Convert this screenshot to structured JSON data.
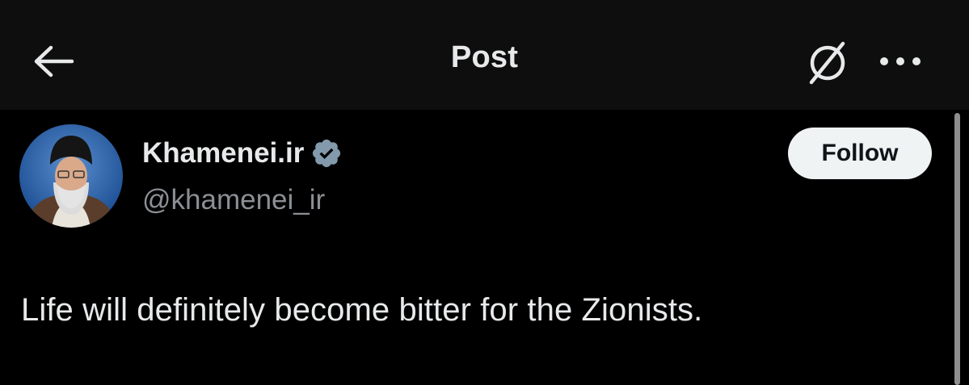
{
  "header": {
    "title": "Post",
    "back_icon": "arrow-left-icon",
    "grok_icon": "grok-slash-icon",
    "more_icon": "more-dots-icon"
  },
  "author": {
    "display_name": "Khamenei.ir",
    "handle": "@khamenei_ir",
    "verified": true,
    "verified_icon": "verified-badge-icon",
    "verified_color": "#829aab"
  },
  "actions": {
    "follow_label": "Follow"
  },
  "post": {
    "text": "Life will definitely become bitter for the Zionists."
  },
  "colors": {
    "background": "#000000",
    "header_background": "#0e0e0e",
    "text_primary": "#e7e9ea",
    "text_secondary": "#8b8f94",
    "button_background": "#eff3f4"
  }
}
